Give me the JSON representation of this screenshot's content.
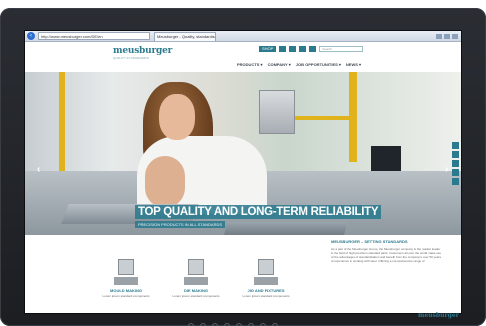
{
  "browser": {
    "address": "http://www.meusburger.com/DE/en",
    "tab_title": "Meusburger - Quality, standardisat...",
    "back_icon": "back-arrow-icon"
  },
  "site": {
    "logo": "meusburger",
    "logo_sub": "QUALITY IN STANDARDS",
    "shop_label": "SHOP",
    "search_placeholder": "Search",
    "nav": [
      "PRODUCTS ▾",
      "COMPANY ▾",
      "JOB OPPORTUNITIES ▾",
      "NEWS ▾"
    ]
  },
  "hero": {
    "headline": "TOP QUALITY AND LONG-TERM RELIABILITY",
    "subline": "PRECISION PRODUCTS IN ALL STANDARDS",
    "prev": "‹",
    "next": "›"
  },
  "products": [
    {
      "title": "MOULD MAKING",
      "text": "Lorem ipsum standard components"
    },
    {
      "title": "DIE MAKING",
      "text": "Lorem ipsum standard components"
    },
    {
      "title": "JIG AND FIXTURES",
      "text": "Lorem ipsum standard components"
    }
  ],
  "article": {
    "title": "MEUSBURGER – SETTING STANDARDS",
    "text": "As a part of the Meusburger Group, the Meusburger company is the market leader in the field of high-precision standard parts. Customers all over the world make use of the advantages of standardisation and benefit from the company's over 50 years of experience in working with steel. Offering a comprehensive range of"
  },
  "bezel": {
    "brand": "meusburger"
  },
  "colors": {
    "brand": "#2b7a8e",
    "accent_yellow": "#e0b21c"
  }
}
